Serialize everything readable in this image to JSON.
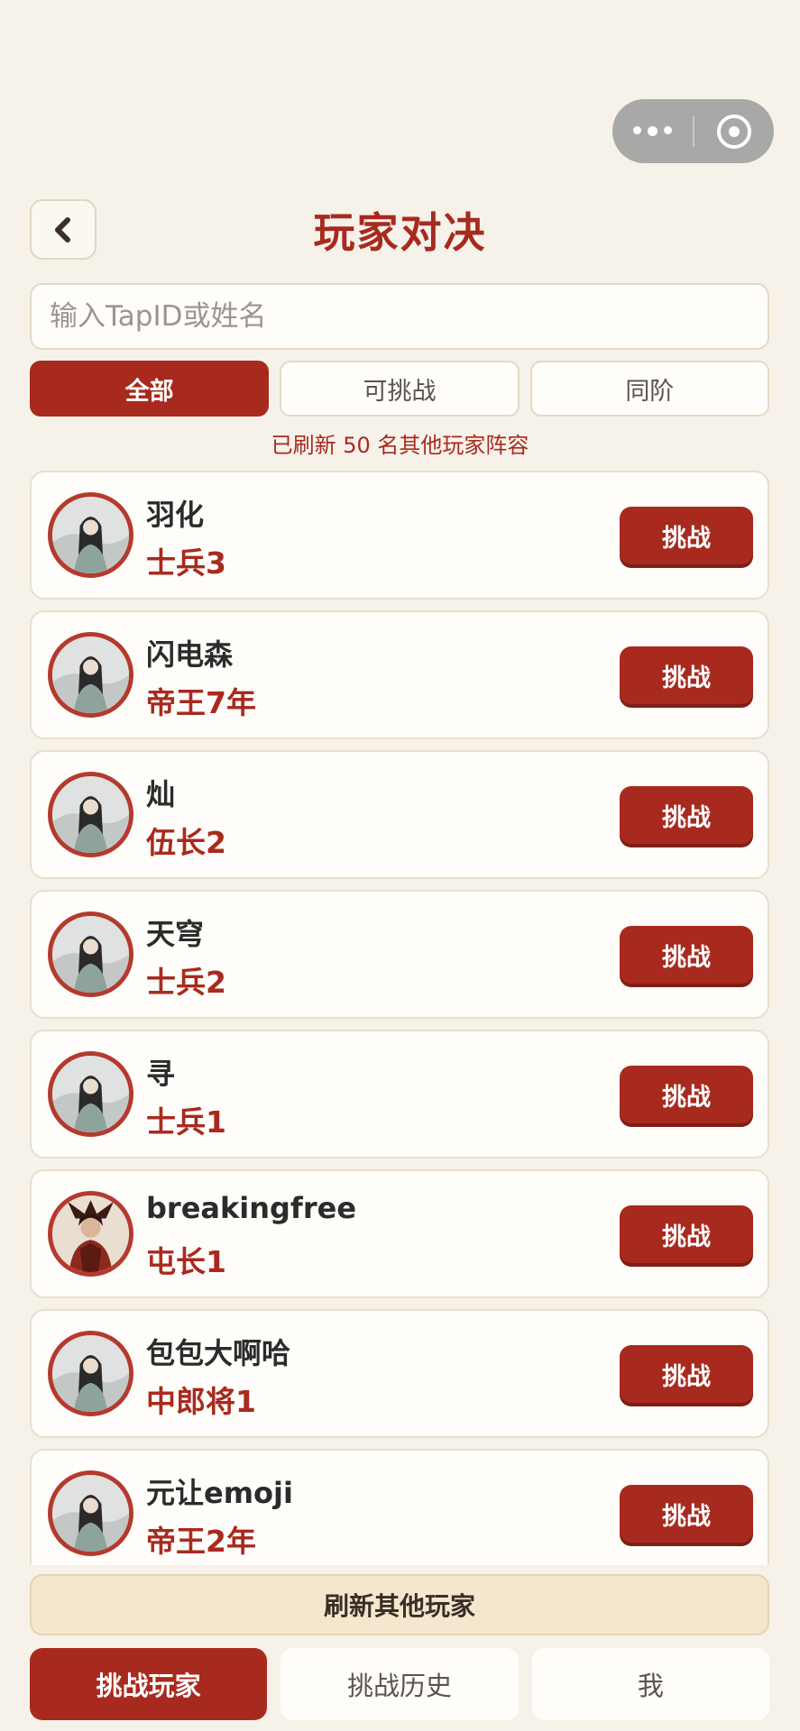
{
  "header": {
    "title": "玩家对决",
    "back_icon": "chevron-left-icon",
    "capsule_icons": [
      "more-dots-icon",
      "close-target-icon"
    ]
  },
  "search": {
    "placeholder": "输入TapID或姓名",
    "value": ""
  },
  "filters": [
    {
      "label": "全部",
      "active": true
    },
    {
      "label": "可挑战",
      "active": false
    },
    {
      "label": "同阶",
      "active": false
    }
  ],
  "refresh_note": "已刷新 50 名其他玩家阵容",
  "players": [
    {
      "name": "羽化",
      "rank": "士兵3",
      "button": "挑战",
      "avatar": "scholar"
    },
    {
      "name": "闪电森",
      "rank": "帝王7年",
      "button": "挑战",
      "avatar": "scholar"
    },
    {
      "name": "灿",
      "rank": "伍长2",
      "button": "挑战",
      "avatar": "scholar"
    },
    {
      "name": "天穹",
      "rank": "士兵2",
      "button": "挑战",
      "avatar": "scholar"
    },
    {
      "name": "寻",
      "rank": "士兵1",
      "button": "挑战",
      "avatar": "scholar"
    },
    {
      "name": "breakingfree",
      "rank": "屯长1",
      "button": "挑战",
      "avatar": "warrior"
    },
    {
      "name": "包包大啊哈",
      "rank": "中郎将1",
      "button": "挑战",
      "avatar": "scholar"
    },
    {
      "name": "元让emoji",
      "rank": "帝王2年",
      "button": "挑战",
      "avatar": "scholar"
    }
  ],
  "refresh_others": "刷新其他玩家",
  "tabs": [
    {
      "label": "挑战玩家",
      "active": true
    },
    {
      "label": "挑战历史",
      "active": false
    },
    {
      "label": "我",
      "active": false
    }
  ],
  "colors": {
    "accent": "#a82a1e",
    "background": "#f6f2ea",
    "card": "#fffdf9"
  }
}
